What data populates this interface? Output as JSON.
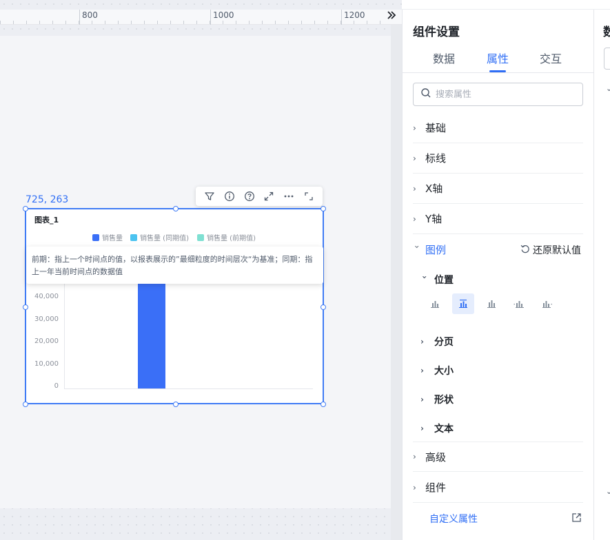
{
  "ruler": {
    "labels": [
      "800",
      "1000",
      "1200"
    ],
    "collapse_icon": "double-chevron-right"
  },
  "canvas": {
    "coordinates": "725, 263"
  },
  "widget": {
    "title": "图表_1",
    "legend": [
      {
        "label": "销售量",
        "color": "#3a6ff7"
      },
      {
        "label": "销售量 (同期值)",
        "color": "#4cc3f0"
      },
      {
        "label": "销售量 (前期值)",
        "color": "#7fe0d2"
      }
    ],
    "tooltip": "前期：指上一个时间点的值，以报表展示的”最细粒度的时间层次“为基准；同期：指上一年当前时间点的数据值",
    "toolbar_icons": [
      "filter-icon",
      "info-icon",
      "help-icon",
      "expand-icon",
      "more-icon",
      "fullscreen-icon"
    ]
  },
  "chart_data": {
    "type": "bar",
    "yticks": [
      "40,000",
      "30,000",
      "20,000",
      "10,000",
      "0"
    ],
    "ylim": [
      0,
      40000
    ],
    "series": [
      {
        "name": "销售量",
        "values": [
          40000
        ]
      }
    ]
  },
  "panel": {
    "title": "组件设置",
    "tabs": [
      {
        "label": "数据",
        "active": false
      },
      {
        "label": "属性",
        "active": true
      },
      {
        "label": "交互",
        "active": false
      }
    ],
    "search_placeholder": "搜索属性",
    "sections": {
      "basic": "基础",
      "markline": "标线",
      "xaxis": "X轴",
      "yaxis": "Y轴",
      "legend": "图例",
      "advanced": "高级",
      "component": "组件"
    },
    "restore_label": "还原默认值",
    "legend_subs": {
      "position": "位置",
      "paging": "分页",
      "size": "大小",
      "shape": "形状",
      "text": "文本"
    },
    "position_options": [
      "legend-pos-left-icon",
      "legend-pos-center-icon",
      "legend-pos-right-icon",
      "legend-pos-inline-left-icon",
      "legend-pos-inline-right-icon"
    ],
    "custom_attr_label": "自定义属性",
    "accent": "#2f6ef5"
  },
  "panel2": {
    "title": "数"
  }
}
